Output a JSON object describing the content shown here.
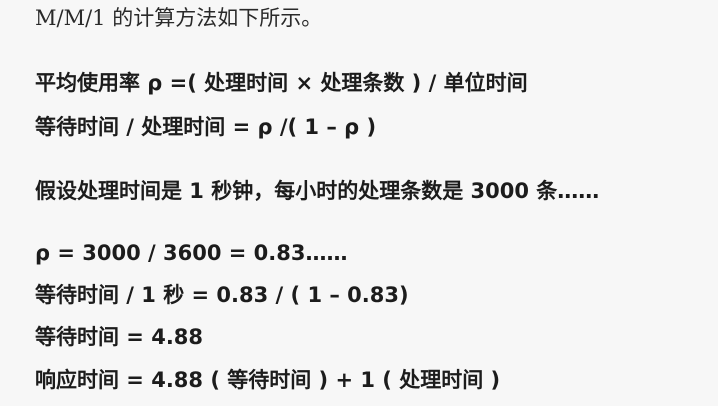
{
  "intro": "M/M/1 的计算方法如下所示。",
  "formulas": {
    "utilization": "平均使用率 ρ =( 处理时间 × 处理条数 ) / 单位时间",
    "wait_ratio": "等待时间 / 处理时间 = ρ /( 1 – ρ )"
  },
  "assumption": "假设处理时间是 1 秒钟，每小时的处理条数是 3000 条……",
  "calculation": {
    "rho": "ρ = 3000 / 3600 = 0.83……",
    "wait_equation": "等待时间 / 1 秒 = 0.83 / ( 1 – 0.83)",
    "wait_result": "等待时间 = 4.88",
    "response_time": "响应时间 = 4.88 ( 等待时间 ) + 1 ( 处理时间 )"
  }
}
